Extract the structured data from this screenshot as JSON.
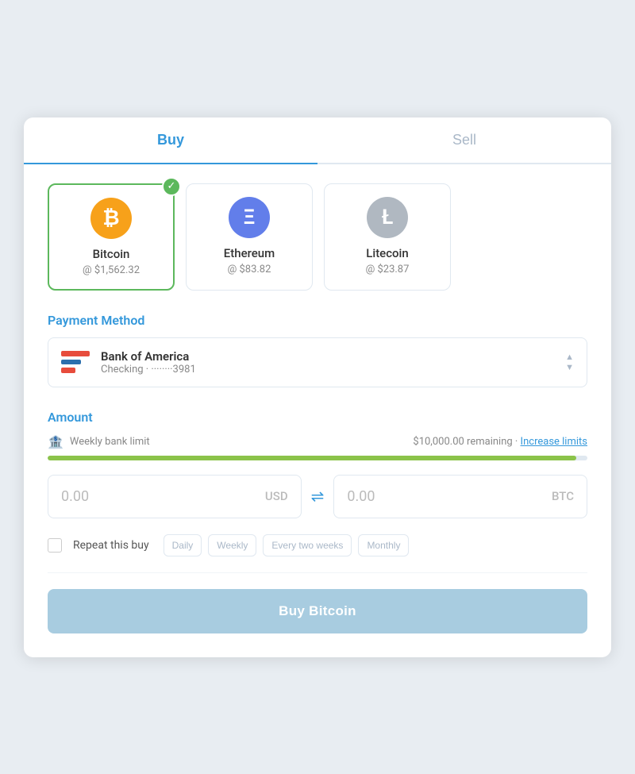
{
  "tabs": [
    {
      "id": "buy",
      "label": "Buy",
      "active": true
    },
    {
      "id": "sell",
      "label": "Sell",
      "active": false
    }
  ],
  "crypto": {
    "items": [
      {
        "id": "bitcoin",
        "name": "Bitcoin",
        "price": "@ $1,562.32",
        "icon": "₿",
        "colorClass": "bitcoin",
        "selected": true
      },
      {
        "id": "ethereum",
        "name": "Ethereum",
        "price": "@ $83.82",
        "icon": "Ξ",
        "colorClass": "ethereum",
        "selected": false
      },
      {
        "id": "litecoin",
        "name": "Litecoin",
        "price": "@ $23.87",
        "icon": "Ł",
        "colorClass": "litecoin",
        "selected": false
      }
    ]
  },
  "payment_method": {
    "section_label": "Payment Method",
    "bank_name": "Bank of America",
    "bank_account": "Checking · ········3981"
  },
  "amount": {
    "section_label": "Amount",
    "limit_label": "Weekly bank limit",
    "limit_remaining": "$10,000.00 remaining",
    "limit_separator": "·",
    "increase_limits_label": "Increase limits",
    "progress_percent": 98,
    "usd_value": "0.00",
    "usd_currency": "USD",
    "btc_value": "0.00",
    "btc_currency": "BTC"
  },
  "repeat": {
    "label": "Repeat this buy",
    "options": [
      {
        "id": "daily",
        "label": "Daily"
      },
      {
        "id": "weekly",
        "label": "Weekly"
      },
      {
        "id": "every_two_weeks",
        "label": "Every two weeks"
      },
      {
        "id": "monthly",
        "label": "Monthly"
      }
    ]
  },
  "buy_button": {
    "label": "Buy Bitcoin"
  }
}
